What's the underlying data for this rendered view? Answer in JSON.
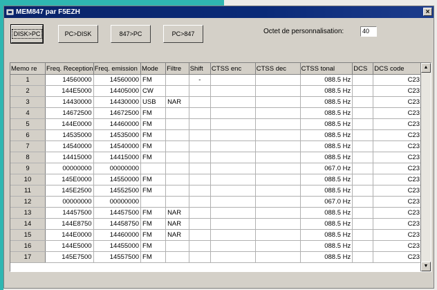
{
  "window": {
    "title": "MEM847 par F5EZH",
    "close_glyph": "×"
  },
  "toolbar": {
    "buttons": [
      {
        "label": "DISK>PC"
      },
      {
        "label": "PC>DISK"
      },
      {
        "label": "847>PC"
      },
      {
        "label": "PC>847"
      }
    ]
  },
  "octet": {
    "label": "Octet de personnalisation:",
    "value": "40"
  },
  "table": {
    "columns": [
      "Memo re",
      "Freq. Reception",
      "Freq. emission",
      "Mode",
      "Filtre",
      "Shift",
      "CTSS enc",
      "CTSS dec",
      "CTSS tonal",
      "DCS",
      "DCS code"
    ],
    "rows": [
      [
        "1",
        "14560000",
        "14560000",
        "FM",
        "",
        "-",
        "",
        "",
        "088.5 Hz",
        "",
        "C23"
      ],
      [
        "2",
        "144E5000",
        "14405000",
        "CW",
        "",
        "",
        "",
        "",
        "088.5 Hz",
        "",
        "C23"
      ],
      [
        "3",
        "14430000",
        "14430000",
        "USB",
        "NAR",
        "",
        "",
        "",
        "088.5 Hz",
        "",
        "C23"
      ],
      [
        "4",
        "14672500",
        "14672500",
        "FM",
        "",
        "",
        "",
        "",
        "088.5 Hz",
        "",
        "C23"
      ],
      [
        "5",
        "144E0000",
        "14460000",
        "FM",
        "",
        "",
        "",
        "",
        "088.5 Hz",
        "",
        "C23"
      ],
      [
        "6",
        "14535000",
        "14535000",
        "FM",
        "",
        "",
        "",
        "",
        "088.5 Hz",
        "",
        "C23"
      ],
      [
        "7",
        "14540000",
        "14540000",
        "FM",
        "",
        "",
        "",
        "",
        "088.5 Hz",
        "",
        "C23"
      ],
      [
        "8",
        "14415000",
        "14415000",
        "FM",
        "",
        "",
        "",
        "",
        "088.5 Hz",
        "",
        "C23"
      ],
      [
        "9",
        "00000000",
        "00000000",
        "",
        "",
        "",
        "",
        "",
        "067.0 Hz",
        "",
        "C23"
      ],
      [
        "10",
        "145E0000",
        "14550000",
        "FM",
        "",
        "",
        "",
        "",
        "088.5 Hz",
        "",
        "C23"
      ],
      [
        "11",
        "145E2500",
        "14552500",
        "FM",
        "",
        "",
        "",
        "",
        "088.5 Hz",
        "",
        "C23"
      ],
      [
        "12",
        "00000000",
        "00000000",
        "",
        "",
        "",
        "",
        "",
        "067.0 Hz",
        "",
        "C23"
      ],
      [
        "13",
        "14457500",
        "14457500",
        "FM",
        "NAR",
        "",
        "",
        "",
        "088.5 Hz",
        "",
        "C23"
      ],
      [
        "14",
        "144E8750",
        "14458750",
        "FM",
        "NAR",
        "",
        "",
        "",
        "088.5 Hz",
        "",
        "C23"
      ],
      [
        "15",
        "144E0000",
        "14460000",
        "FM",
        "NAR",
        "",
        "",
        "",
        "088.5 Hz",
        "",
        "C23"
      ],
      [
        "16",
        "144E5000",
        "14455000",
        "FM",
        "",
        "",
        "",
        "",
        "088.5 Hz",
        "",
        "C23"
      ],
      [
        "17",
        "145E7500",
        "14557500",
        "FM",
        "",
        "",
        "",
        "",
        "088.5 Hz",
        "",
        "C23"
      ]
    ]
  },
  "scrollbar": {
    "up_glyph": "▲",
    "down_glyph": "▼"
  },
  "colors": {
    "titlebar": "#0a246a",
    "face": "#d4d0c8",
    "accent": "#2fb6b1"
  },
  "icons": {
    "app": "app-icon"
  }
}
